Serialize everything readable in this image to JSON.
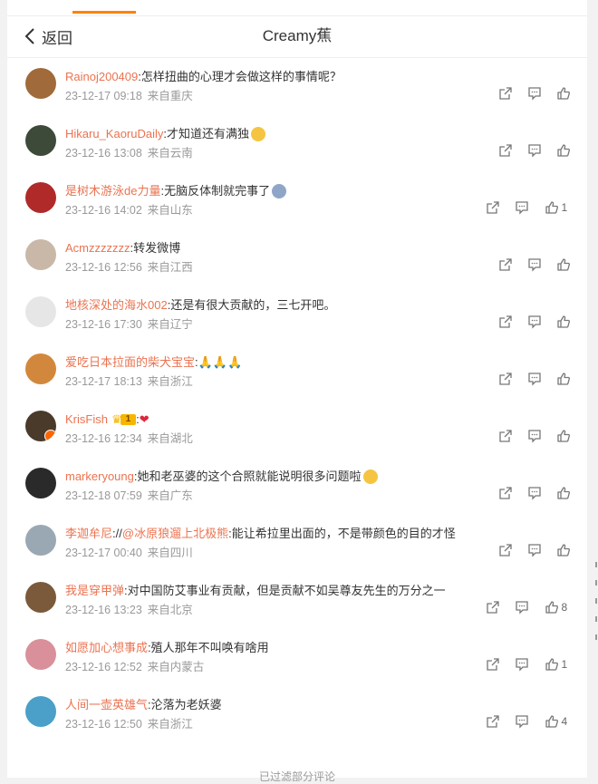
{
  "header": {
    "back_label": "返回",
    "title": "Creamy蕉"
  },
  "comments": [
    {
      "user": "Rainoj200409",
      "text": "怎样扭曲的心理才会做这样的事情呢？",
      "date": "23-12-17 09:18",
      "location": "来自重庆",
      "likes": "",
      "avatar_color": "#a06a3a"
    },
    {
      "user": "Hikaru_KaoruDaily",
      "text": "才知道还有满独",
      "emoji": "sweat-smile-emoji",
      "date": "23-12-16 13:08",
      "location": "来自云南",
      "likes": "",
      "avatar_color": "#3d4a3a"
    },
    {
      "user": "是树木游泳de力量",
      "text": "无脑反体制就完事了",
      "emoji": "scared-face-emoji",
      "date": "23-12-16 14:02",
      "location": "来自山东",
      "likes": "1",
      "avatar_color": "#b02a2a"
    },
    {
      "user": "Acmzzzzzzz",
      "text": "转发微博",
      "date": "23-12-16 12:56",
      "location": "来自江西",
      "likes": "",
      "avatar_color": "#c9b8a8"
    },
    {
      "user": "地核深处的海水002",
      "text": "还是有很大贡献的，三七开吧。",
      "date": "23-12-16 17:30",
      "location": "来自辽宁",
      "likes": "",
      "avatar_color": "#e6e6e6"
    },
    {
      "user": "爱吃日本拉面的柴犬宝宝",
      "text": "🙏🙏🙏",
      "date": "23-12-17 18:13",
      "location": "来自浙江",
      "likes": "",
      "avatar_color": "#d2883c"
    },
    {
      "user": "KrisFish",
      "text": "❤",
      "vip_level": "1",
      "date": "23-12-16 12:34",
      "location": "来自湖北",
      "likes": "",
      "avatar_color": "#4a3a2a"
    },
    {
      "user": "markeryoung",
      "text": "她和老巫婆的这个合照就能说明很多问题啦",
      "emoji": "hug-emoji",
      "date": "23-12-18 07:59",
      "location": "来自广东",
      "likes": "",
      "avatar_color": "#2a2a2a"
    },
    {
      "user": "李迦牟尼",
      "text_prefix": "//",
      "mention": "@冰原狼遛上北极熊",
      "text": "能让希拉里出面的，不是带颜色的目的才怪",
      "date": "23-12-17 00:40",
      "location": "来自四川",
      "likes": "",
      "avatar_color": "#9aa8b4"
    },
    {
      "user": "我是穿甲弹",
      "text": "对中国防艾事业有贡献，但是贡献不如吴尊友先生的万分之一",
      "date": "23-12-16 13:23",
      "location": "来自北京",
      "likes": "8",
      "avatar_color": "#7a5a3a"
    },
    {
      "user": "如愿加心想事成",
      "text": "殖人那年不叫唤有啥用",
      "date": "23-12-16 12:52",
      "location": "来自内蒙古",
      "likes": "1",
      "avatar_color": "#d9909a"
    },
    {
      "user": "人间一壶英雄气",
      "text": "沦落为老妖婆",
      "date": "23-12-16 12:50",
      "location": "来自浙江",
      "likes": "4",
      "avatar_color": "#4aa0c8"
    }
  ],
  "footer": {
    "more_label": "已过滤部分评论"
  },
  "colors": {
    "accent": "#ff8200",
    "username": "#eb7350",
    "meta": "#999999"
  }
}
